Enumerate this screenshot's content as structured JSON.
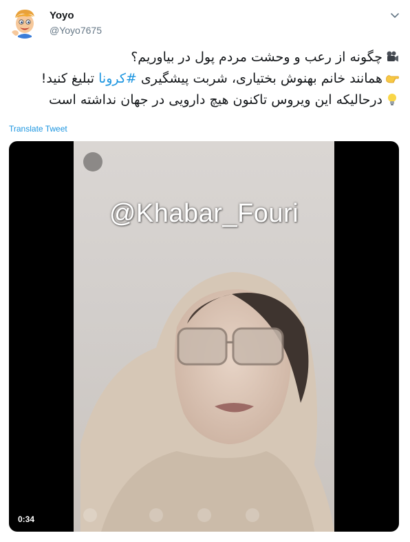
{
  "author": {
    "name": "Yoyo",
    "handle": "@Yoyo7675",
    "avatar_icon": "cartoon-boy-avatar"
  },
  "menu_icon": "chevron-down-icon",
  "tweet": {
    "lines": [
      {
        "emoji": "movie-camera-icon",
        "before": "چگونه از رعب و وحشت مردم پول در بیاوریم؟",
        "hashtag": "",
        "after": ""
      },
      {
        "emoji": "pointing-hand-icon",
        "before": "همانند خانم بهنوش بختیاری، شربت پیشگیری ",
        "hashtag": "#کرونا",
        "after": " تبلیغ کنید!"
      },
      {
        "emoji": "light-bulb-icon",
        "before": "درحالیکه این ویروس تاکنون هیچ دارویی در جهان نداشته است",
        "hashtag": "",
        "after": ""
      }
    ]
  },
  "translate_label": "Translate Tweet",
  "video": {
    "watermark": "@Khabar_Fouri",
    "duration": "0:34"
  },
  "colors": {
    "link": "#1b95e0",
    "handle": "#657786",
    "text": "#14171a",
    "video_bg": "#000000"
  }
}
